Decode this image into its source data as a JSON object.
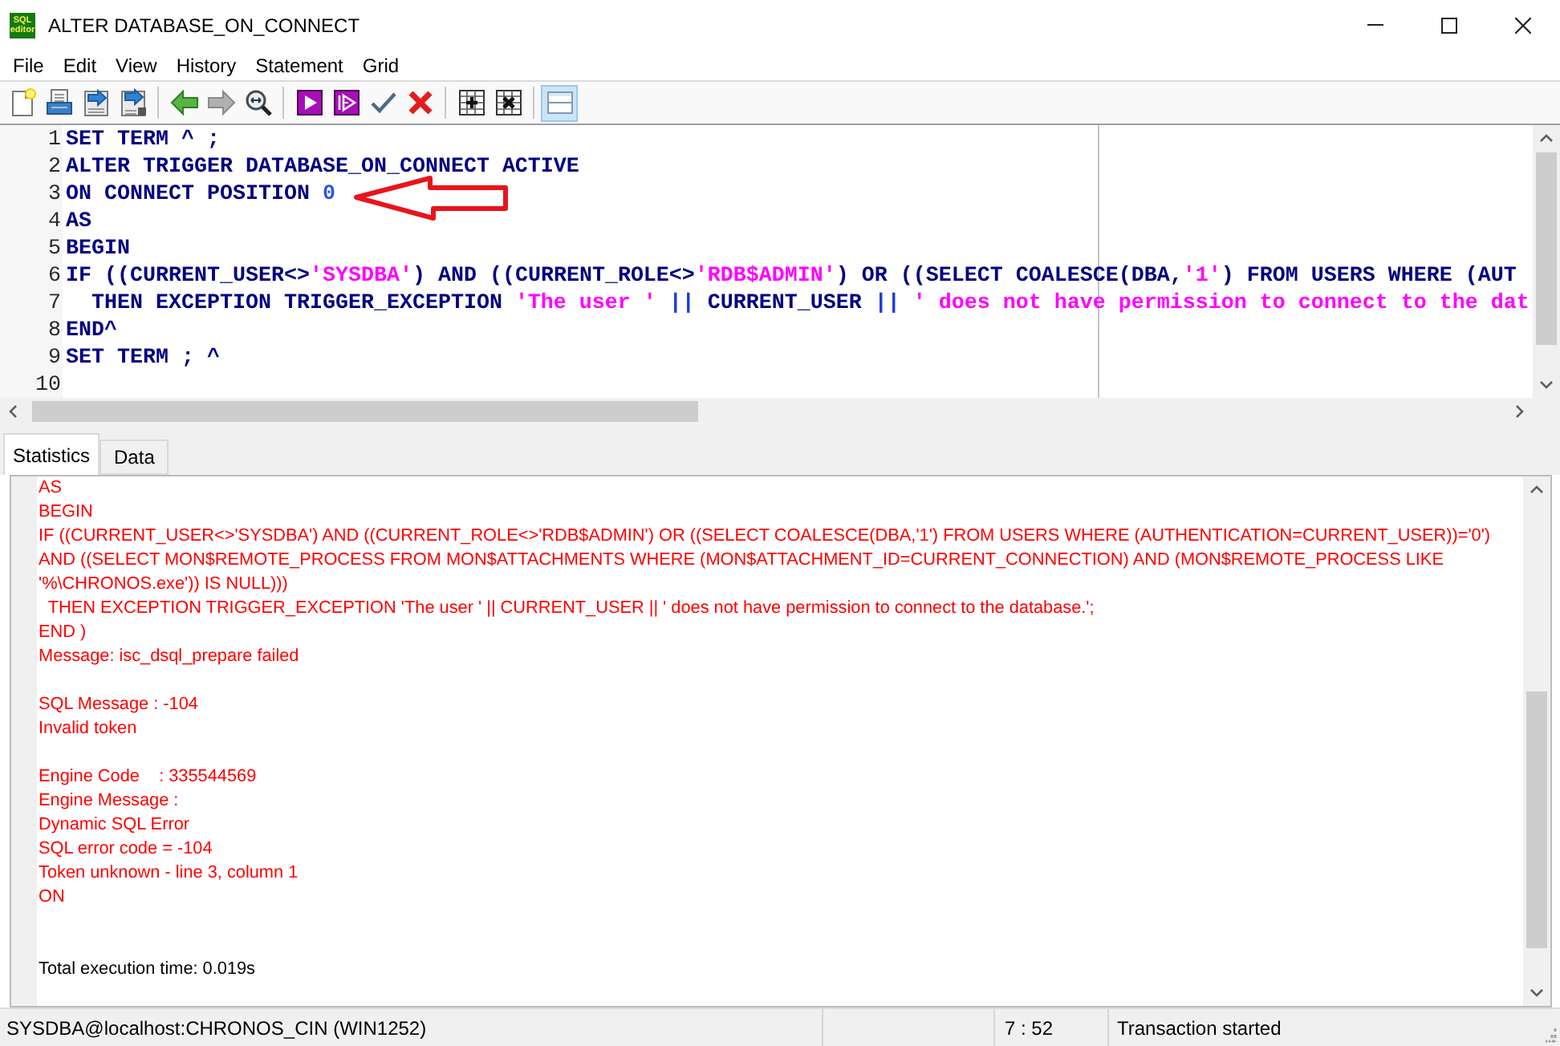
{
  "window": {
    "title": "ALTER DATABASE_ON_CONNECT",
    "logo": [
      "SQL",
      "editor"
    ]
  },
  "menu": [
    "File",
    "Edit",
    "View",
    "History",
    "Statement",
    "Grid"
  ],
  "toolbar": [
    [
      {
        "kind": "new",
        "disabled": false,
        "pressed": false
      },
      {
        "kind": "open",
        "disabled": false,
        "pressed": false
      },
      {
        "kind": "load",
        "disabled": false,
        "pressed": false
      },
      {
        "kind": "save",
        "disabled": false,
        "pressed": false
      }
    ],
    [
      {
        "kind": "back",
        "disabled": false,
        "pressed": false
      },
      {
        "kind": "forward",
        "disabled": true,
        "pressed": false
      },
      {
        "kind": "zoom",
        "disabled": false,
        "pressed": false
      }
    ],
    [
      {
        "kind": "run",
        "disabled": false,
        "pressed": false
      },
      {
        "kind": "step",
        "disabled": false,
        "pressed": false
      },
      {
        "kind": "commit",
        "disabled": false,
        "pressed": false
      },
      {
        "kind": "rollback",
        "disabled": false,
        "pressed": false
      }
    ],
    [
      {
        "kind": "grid_add",
        "disabled": false,
        "pressed": false
      },
      {
        "kind": "grid_remove",
        "disabled": false,
        "pressed": false
      }
    ],
    [
      {
        "kind": "layout",
        "disabled": false,
        "pressed": true
      }
    ]
  ],
  "editor": {
    "lines": [
      {
        "number": "1",
        "tokens": [
          {
            "kind": "keyword",
            "text": "SET TERM ^ ;"
          }
        ]
      },
      {
        "number": "2",
        "tokens": [
          {
            "kind": "keyword",
            "text": "ALTER TRIGGER DATABASE_ON_CONNECT ACTIVE"
          }
        ]
      },
      {
        "number": "3",
        "tokens": [
          {
            "kind": "keyword",
            "text": "ON CONNECT POSITION "
          },
          {
            "kind": "number",
            "text": "0"
          }
        ]
      },
      {
        "number": "4",
        "tokens": [
          {
            "kind": "keyword",
            "text": "AS"
          }
        ]
      },
      {
        "number": "5",
        "tokens": [
          {
            "kind": "keyword",
            "text": "BEGIN"
          }
        ]
      },
      {
        "number": "6",
        "tokens": [
          {
            "kind": "keyword",
            "text": "IF ((CURRENT_USER<>"
          },
          {
            "kind": "string",
            "text": "'SYSDBA'"
          },
          {
            "kind": "keyword",
            "text": ") AND ((CURRENT_ROLE<>"
          },
          {
            "kind": "string",
            "text": "'RDB$ADMIN'"
          },
          {
            "kind": "keyword",
            "text": ") OR ((SELECT COALESCE(DBA,"
          },
          {
            "kind": "string",
            "text": "'1'"
          },
          {
            "kind": "keyword",
            "text": ") FROM USERS WHERE (AUT"
          }
        ]
      },
      {
        "number": "7",
        "tokens": [
          {
            "kind": "keyword",
            "text": "  THEN EXCEPTION TRIGGER_EXCEPTION "
          },
          {
            "kind": "string",
            "text": "'The user '"
          },
          {
            "kind": "operator",
            "text": " || "
          },
          {
            "kind": "keyword",
            "text": "CURRENT_USER"
          },
          {
            "kind": "operator",
            "text": " || "
          },
          {
            "kind": "string",
            "text": "' does not have permission to connect to the dat"
          }
        ]
      },
      {
        "number": "8",
        "tokens": [
          {
            "kind": "keyword",
            "text": "END^"
          }
        ]
      },
      {
        "number": "9",
        "tokens": [
          {
            "kind": "keyword",
            "text": "SET TERM ; ^"
          }
        ]
      },
      {
        "number": "10"
      }
    ]
  },
  "result_tabs": [
    {
      "label": "Statistics",
      "selected": true
    },
    {
      "label": "Data",
      "selected": false
    }
  ],
  "log": [
    {
      "kind": "error",
      "lines": [
        "AS",
        "BEGIN",
        "IF ((CURRENT_USER<>'SYSDBA') AND ((CURRENT_ROLE<>'RDB$ADMIN') OR ((SELECT COALESCE(DBA,'1') FROM USERS WHERE (AUTHENTICATION=CURRENT_USER))='0')",
        "AND ((SELECT MON$REMOTE_PROCESS FROM MON$ATTACHMENTS WHERE (MON$ATTACHMENT_ID=CURRENT_CONNECTION) AND (MON$REMOTE_PROCESS LIKE",
        "'%\\CHRONOS.exe')) IS NULL)))",
        "  THEN EXCEPTION TRIGGER_EXCEPTION 'The user ' || CURRENT_USER || ' does not have permission to connect to the database.';",
        "END )",
        "Message: isc_dsql_prepare failed"
      ]
    },
    {
      "kind": "error",
      "lines": [
        "SQL Message : -104",
        "Invalid token"
      ]
    },
    {
      "kind": "error",
      "lines": [
        "Engine Code    : 335544569",
        "Engine Message :",
        "Dynamic SQL Error",
        "SQL error code = -104",
        "Token unknown - line 3, column 1",
        "ON"
      ]
    },
    {
      "kind": "summary",
      "lines": [
        "Total execution time: 0.019s"
      ]
    }
  ],
  "status_bar": {
    "connection": "SYSDBA@localhost:CHRONOS_CIN (WIN1252)",
    "cursor": "7 : 52",
    "message": "Transaction started"
  }
}
